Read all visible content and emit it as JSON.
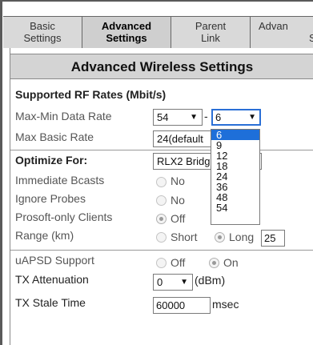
{
  "tabs": [
    {
      "line1": "Basic",
      "line2": "Settings"
    },
    {
      "line1": "Advanced",
      "line2": "Settings"
    },
    {
      "line1": "Parent",
      "line2": "Link"
    },
    {
      "line1": "Advan",
      "line2": "S"
    }
  ],
  "title": "Advanced Wireless Settings",
  "rf": {
    "header": "Supported RF Rates (Mbit/s)",
    "max_min_label": "Max-Min Data Rate",
    "max_value": "54",
    "dash": "-",
    "min_value": "6",
    "max_basic_label": "Max Basic Rate",
    "max_basic_value": "24(default"
  },
  "min_rate_options": [
    "6",
    "9",
    "12",
    "18",
    "24",
    "36",
    "48",
    "54"
  ],
  "optimize": {
    "label": "Optimize For:",
    "value": "RLX2 Bridge"
  },
  "immediate_bcasts": {
    "label": "Immediate Bcasts",
    "option": "No"
  },
  "ignore_probes": {
    "label": "Ignore Probes",
    "option": "No"
  },
  "prosoft_clients": {
    "label": "Prosoft-only Clients",
    "option": "Off"
  },
  "range": {
    "label": "Range (km)",
    "short": "Short",
    "long": "Long",
    "value": "25"
  },
  "uapsd": {
    "label": "uAPSD Support",
    "off": "Off",
    "on": "On"
  },
  "tx_atten": {
    "label": "TX Attenuation",
    "value": "0",
    "unit": "(dBm)"
  },
  "tx_stale": {
    "label": "TX Stale Time",
    "value": "60000",
    "unit": "msec"
  },
  "icons": {
    "dropdown_arrow": "▼"
  }
}
